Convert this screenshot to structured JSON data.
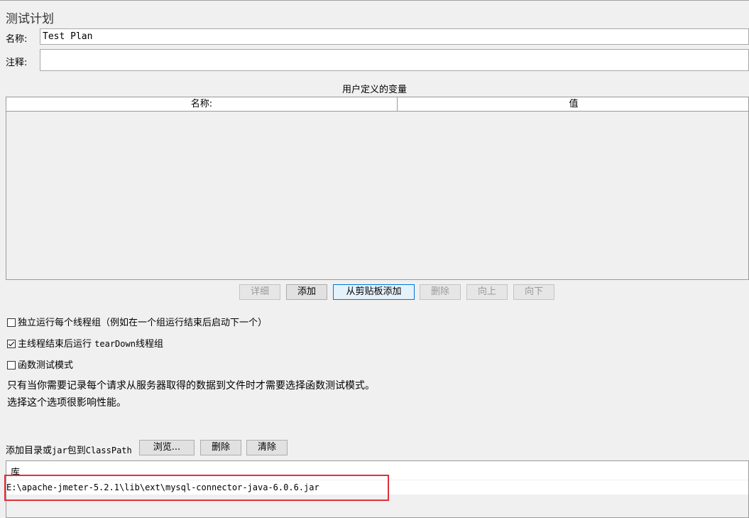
{
  "panel": {
    "title": "测试计划",
    "name_label": "名称:",
    "name_value": "Test Plan",
    "comment_label": "注释:",
    "comment_value": ""
  },
  "variables": {
    "caption": "用户定义的变量",
    "columns": [
      "名称:",
      "值"
    ],
    "rows": [],
    "buttons": {
      "detail": "详细",
      "add": "添加",
      "add_from_clipboard": "从剪贴板添加",
      "delete": "删除",
      "up": "向上",
      "down": "向下"
    }
  },
  "options": {
    "run_thread_groups_independently": {
      "label": "独立运行每个线程组（例如在一个组运行结束后启动下一个）",
      "checked": false
    },
    "teardown_after_shutdown": {
      "label_prefix": "主线程结束后运行 ",
      "label_code": "tearDown",
      "label_suffix": "线程组",
      "checked": true
    },
    "functional_test_mode": {
      "label": "函数测试模式",
      "checked": false
    }
  },
  "info_text": {
    "line1": "只有当你需要记录每个请求从服务器取得的数据到文件时才需要选择函数测试模式。",
    "line2": "选择这个选项很影响性能。"
  },
  "classpath": {
    "label_prefix": "添加目录或",
    "label_code1": "jar",
    "label_mid": "包到",
    "label_code2": "ClassPath",
    "browse_button": "浏览...",
    "delete_button": "删除",
    "clear_button": "清除",
    "library_header": "库",
    "libraries": [
      "E:\\apache-jmeter-5.2.1\\lib\\ext\\mysql-connector-java-6.0.6.jar"
    ]
  },
  "colors": {
    "highlight": "#e0303b",
    "focus": "#0078d7"
  }
}
